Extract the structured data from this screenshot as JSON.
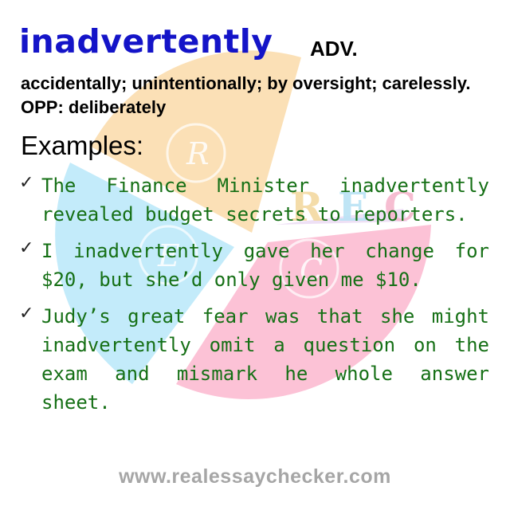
{
  "entry": {
    "headword": "inadvertently",
    "part_of_speech": "ADV.",
    "definition": "accidentally; unintentionally; by oversight; carelessly. OPP: deliberately"
  },
  "examples_title": "Examples:",
  "examples": [
    "The Finance Minister inadvertently revealed budget secrets to reporters.",
    "I inadvertently gave her change for $20, but she’d only given me $10.",
    "Judy’s great fear was that she might inadvertently omit a question on the exam and mismark he whole answer sheet."
  ],
  "bullet_icon": "check-mark-icon",
  "footer": {
    "website": "www.realessaychecker.com"
  },
  "watermark": {
    "icon": "rec-logo-watermark",
    "colors": {
      "orange": "#fbe0b6",
      "blue": "#c3ebfa",
      "pink": "#fcc2d6"
    }
  },
  "colors": {
    "headword": "#1414c8",
    "example_text": "#167016",
    "website": "#a6a6a6"
  }
}
